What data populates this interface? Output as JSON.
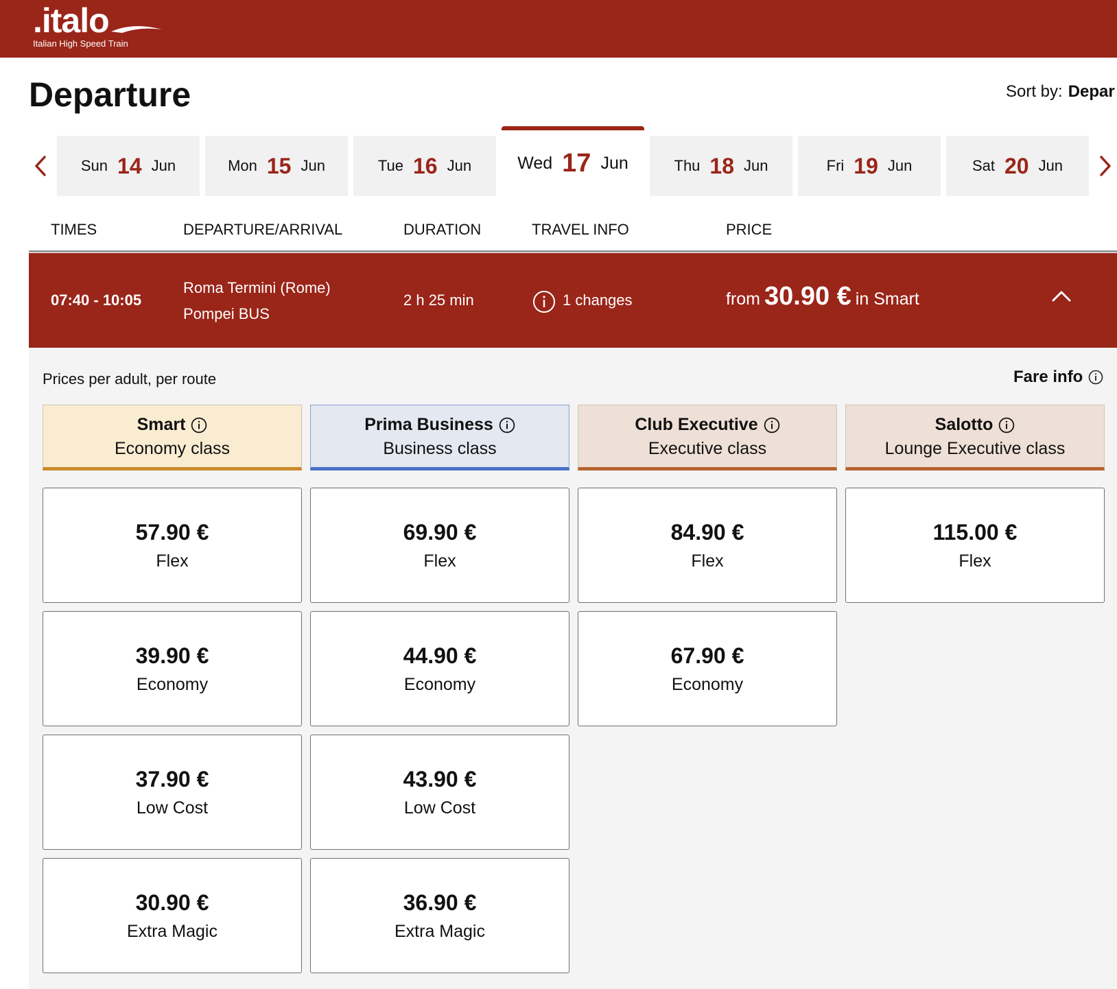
{
  "header": {
    "logo_text": ".italo",
    "logo_tagline": "Italian High Speed Train",
    "brand_color": "#9a2519"
  },
  "page": {
    "title": "Departure",
    "sort_label": "Sort by:",
    "sort_value": "Depar"
  },
  "days": [
    {
      "dow": "Sun",
      "num": "14",
      "mon": "Jun"
    },
    {
      "dow": "Mon",
      "num": "15",
      "mon": "Jun"
    },
    {
      "dow": "Tue",
      "num": "16",
      "mon": "Jun"
    },
    {
      "dow": "Wed",
      "num": "17",
      "mon": "Jun"
    },
    {
      "dow": "Thu",
      "num": "18",
      "mon": "Jun"
    },
    {
      "dow": "Fri",
      "num": "19",
      "mon": "Jun"
    },
    {
      "dow": "Sat",
      "num": "20",
      "mon": "Jun"
    }
  ],
  "columns": {
    "times": "TIMES",
    "dep_arr": "DEPARTURE/ARRIVAL",
    "duration": "DURATION",
    "travel_info": "TRAVEL INFO",
    "price": "PRICE"
  },
  "train": {
    "times": "07:40 - 10:05",
    "from_station": "Roma Termini (Rome)",
    "to_station": "Pompei BUS",
    "duration": "2 h 25 min",
    "changes": "1 changes",
    "price_prefix": "from",
    "price_value": "30.90 €",
    "price_suffix": "in Smart"
  },
  "fares": {
    "note": "Prices per adult, per route",
    "fare_info_label": "Fare info",
    "classes": [
      {
        "name": "Smart",
        "sub": "Economy class",
        "bg": "#f9ecd1",
        "accent": "#c98a2c"
      },
      {
        "name": "Prima Business",
        "sub": "Business class",
        "bg": "#e3e8f1",
        "accent": "#4a72c8"
      },
      {
        "name": "Club Executive",
        "sub": "Executive class",
        "bg": "#eee0d6",
        "accent": "#b5652f"
      },
      {
        "name": "Salotto",
        "sub": "Lounge Executive class",
        "bg": "#eee0d6",
        "accent": "#b5652f"
      }
    ],
    "grid": [
      [
        {
          "amount": "57.90 €",
          "name": "Flex"
        },
        {
          "amount": "39.90 €",
          "name": "Economy"
        },
        {
          "amount": "37.90 €",
          "name": "Low Cost"
        },
        {
          "amount": "30.90 €",
          "name": "Extra Magic"
        }
      ],
      [
        {
          "amount": "69.90 €",
          "name": "Flex"
        },
        {
          "amount": "44.90 €",
          "name": "Economy"
        },
        {
          "amount": "43.90 €",
          "name": "Low Cost"
        },
        {
          "amount": "36.90 €",
          "name": "Extra Magic"
        }
      ],
      [
        {
          "amount": "84.90 €",
          "name": "Flex"
        },
        {
          "amount": "67.90 €",
          "name": "Economy"
        }
      ],
      [
        {
          "amount": "115.00 €",
          "name": "Flex"
        }
      ]
    ]
  }
}
